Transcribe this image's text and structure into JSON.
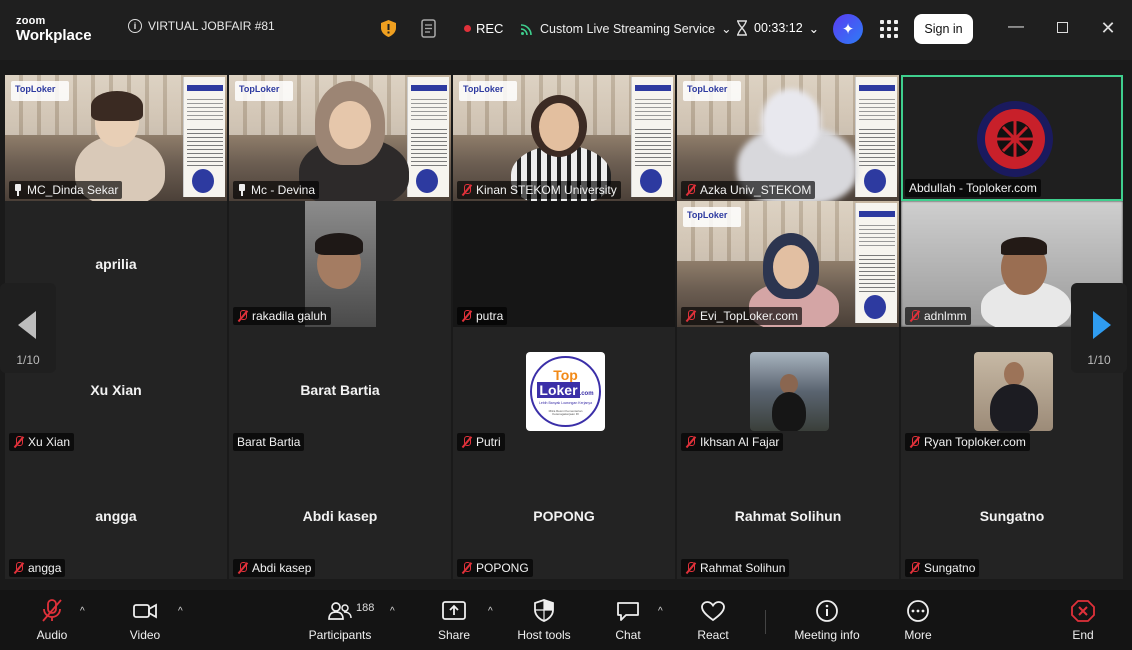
{
  "app": {
    "logo_top": "zoom",
    "logo_bottom": "Workplace"
  },
  "header": {
    "meeting_title": "VIRTUAL JOBFAIR #81",
    "rec_label": "REC",
    "stream_label": "Custom Live Streaming Service",
    "timer": "00:33:12",
    "signin_label": "Sign in"
  },
  "colors": {
    "active_border": "#3fcf8e",
    "rec": "#e0313a",
    "accent": "#2f9cf0",
    "end": "#e0313a"
  },
  "tiles": [
    {
      "label": "MC_Dinda Sekar",
      "center": "",
      "icon": "pin-icon"
    },
    {
      "label": "Mc - Devina",
      "center": "",
      "icon": "pin-icon"
    },
    {
      "label": "Kinan STEKOM University",
      "center": "",
      "icon": "mute-icon"
    },
    {
      "label": "Azka Univ_STEKOM",
      "center": "",
      "icon": "mute-icon"
    },
    {
      "label": "Abdullah - Toploker.com",
      "center": "",
      "icon": ""
    },
    {
      "label": "a",
      "center": "aprilia",
      "icon": ""
    },
    {
      "label": "rakadila galuh",
      "center": "",
      "icon": "mute-icon"
    },
    {
      "label": "putra",
      "center": "",
      "icon": "mute-icon"
    },
    {
      "label": "Evi_TopLoker.com",
      "center": "",
      "icon": "mute-icon"
    },
    {
      "label": "adnlmm",
      "center": "",
      "icon": "mute-icon"
    },
    {
      "label": "Xu Xian",
      "center": "Xu Xian",
      "icon": "mute-icon"
    },
    {
      "label": "Barat Bartia",
      "center": "Barat Bartia",
      "icon": ""
    },
    {
      "label": "Putri",
      "center": "",
      "icon": "mute-icon"
    },
    {
      "label": "Ikhsan Al Fajar",
      "center": "",
      "icon": "mute-icon"
    },
    {
      "label": "Ryan Toploker.com",
      "center": "",
      "icon": "mute-icon"
    },
    {
      "label": "angga",
      "center": "angga",
      "icon": "mute-icon"
    },
    {
      "label": "Abdi kasep",
      "center": "Abdi kasep",
      "icon": "mute-icon"
    },
    {
      "label": "POPONG",
      "center": "POPONG",
      "icon": "mute-icon"
    },
    {
      "label": "Rahmat Solihun",
      "center": "Rahmat Solihun",
      "icon": "mute-icon"
    },
    {
      "label": "Sungatno",
      "center": "Sungatno",
      "icon": "mute-icon"
    }
  ],
  "poster_brand": "TopLoker",
  "putri_logo": {
    "line1": "Top",
    "line2": "Loker",
    "suffix": ".com",
    "tagline": "Lebih Banyak Lowongan Kerjanya",
    "sub": "Mitra Resmi Kementerian Ketenagakerjaan RI"
  },
  "pager": {
    "left_page": "1/10",
    "right_page": "1/10"
  },
  "toolbar": {
    "audio": "Audio",
    "video": "Video",
    "participants": "Participants",
    "participants_count": "188",
    "share": "Share",
    "host_tools": "Host tools",
    "chat": "Chat",
    "react": "React",
    "meeting_info": "Meeting info",
    "more": "More",
    "end": "End"
  }
}
